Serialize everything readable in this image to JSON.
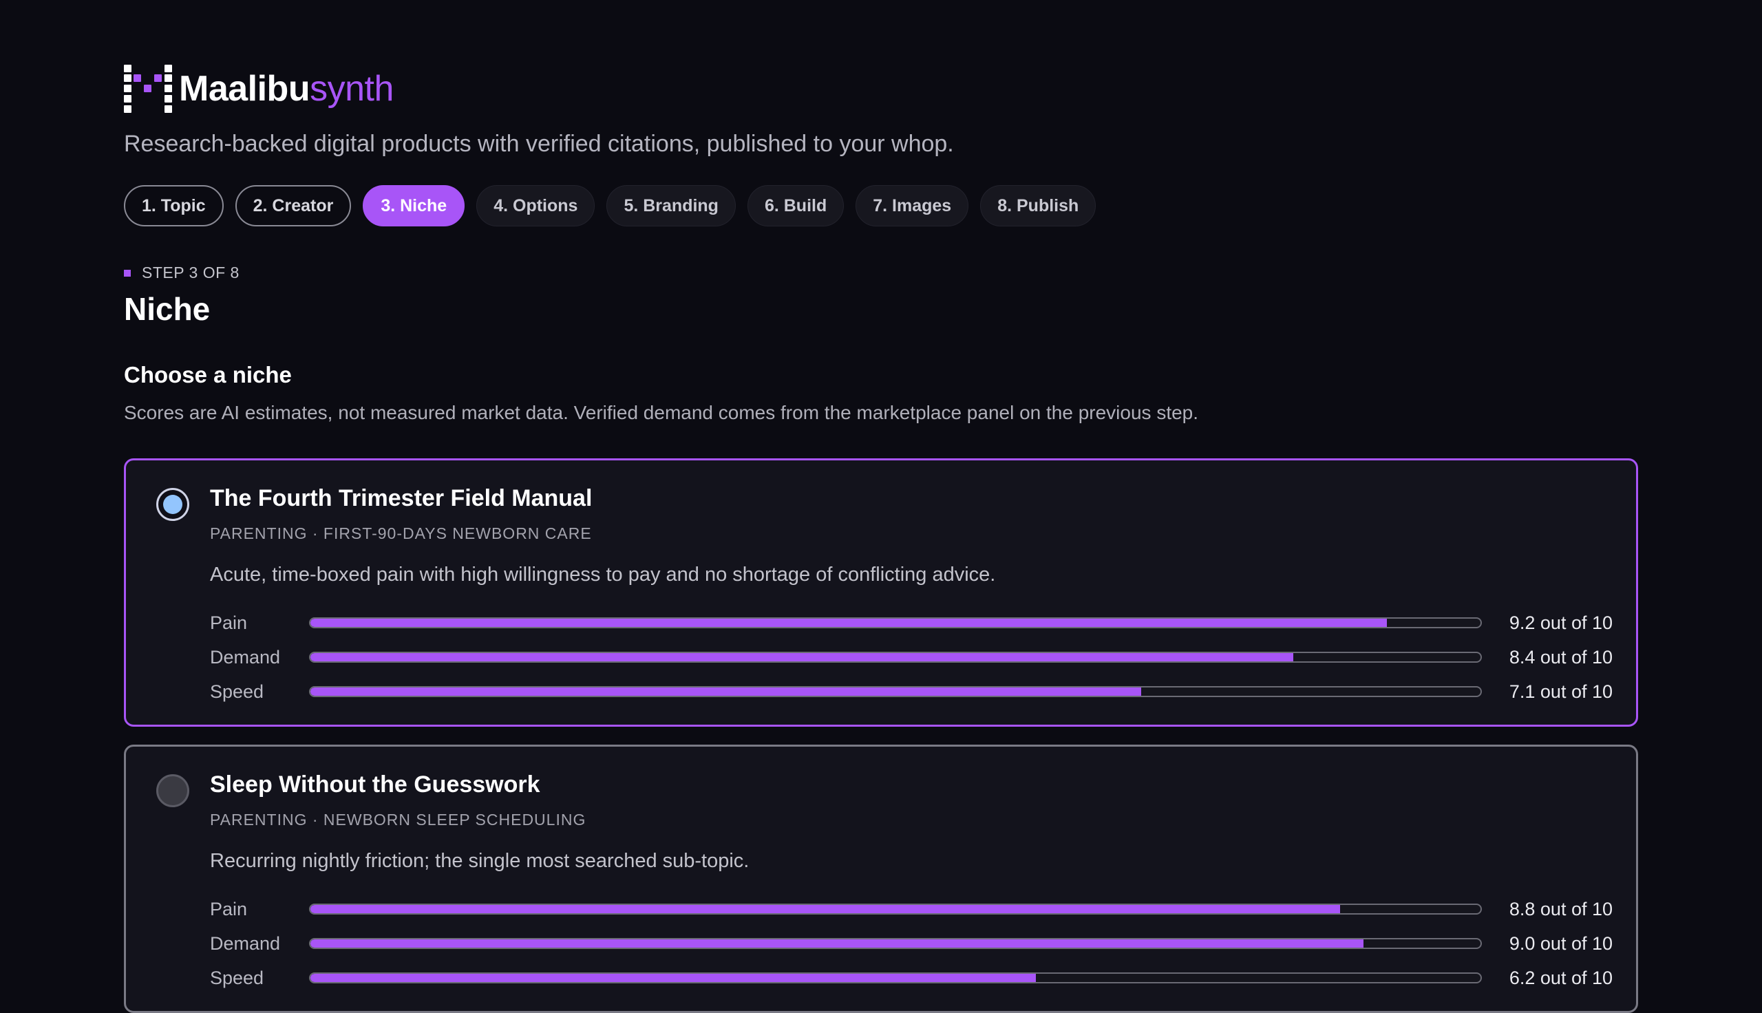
{
  "brand": {
    "name_part1": "Maalibu",
    "name_part2": "synth",
    "tagline": "Research-backed digital products with verified citations, published to your whop."
  },
  "tabs": [
    {
      "label": "1. Topic",
      "state": "done"
    },
    {
      "label": "2. Creator",
      "state": "done"
    },
    {
      "label": "3. Niche",
      "state": "active"
    },
    {
      "label": "4. Options",
      "state": "upcoming"
    },
    {
      "label": "5. Branding",
      "state": "upcoming"
    },
    {
      "label": "6. Build",
      "state": "upcoming"
    },
    {
      "label": "7. Images",
      "state": "upcoming"
    },
    {
      "label": "8. Publish",
      "state": "upcoming"
    }
  ],
  "step": {
    "label": "STEP 3 OF 8",
    "title": "Niche"
  },
  "section": {
    "title": "Choose a niche",
    "note": "Scores are AI estimates, not measured market data. Verified demand comes from the marketplace panel on the previous step."
  },
  "niches": [
    {
      "title": "The Fourth Trimester Field Manual",
      "meta": "PARENTING · FIRST-90-DAYS NEWBORN CARE",
      "description": "Acute, time-boxed pain with high willingness to pay and no shortage of conflicting advice.",
      "selected": true,
      "metrics": [
        {
          "label": "Pain",
          "score": 9.2,
          "value_text": "9.2 out of 10"
        },
        {
          "label": "Demand",
          "score": 8.4,
          "value_text": "8.4 out of 10"
        },
        {
          "label": "Speed",
          "score": 7.1,
          "value_text": "7.1 out of 10"
        }
      ]
    },
    {
      "title": "Sleep Without the Guesswork",
      "meta": "PARENTING · NEWBORN SLEEP SCHEDULING",
      "description": "Recurring nightly friction; the single most searched sub-topic.",
      "selected": false,
      "metrics": [
        {
          "label": "Pain",
          "score": 8.8,
          "value_text": "8.8 out of 10"
        },
        {
          "label": "Demand",
          "score": 9.0,
          "value_text": "9.0 out of 10"
        },
        {
          "label": "Speed",
          "score": 6.2,
          "value_text": "6.2 out of 10"
        }
      ]
    }
  ],
  "colors": {
    "accent": "#a855f7",
    "background": "#0b0b12",
    "card": "#13131c",
    "radio_selected": "#93c5fd"
  }
}
